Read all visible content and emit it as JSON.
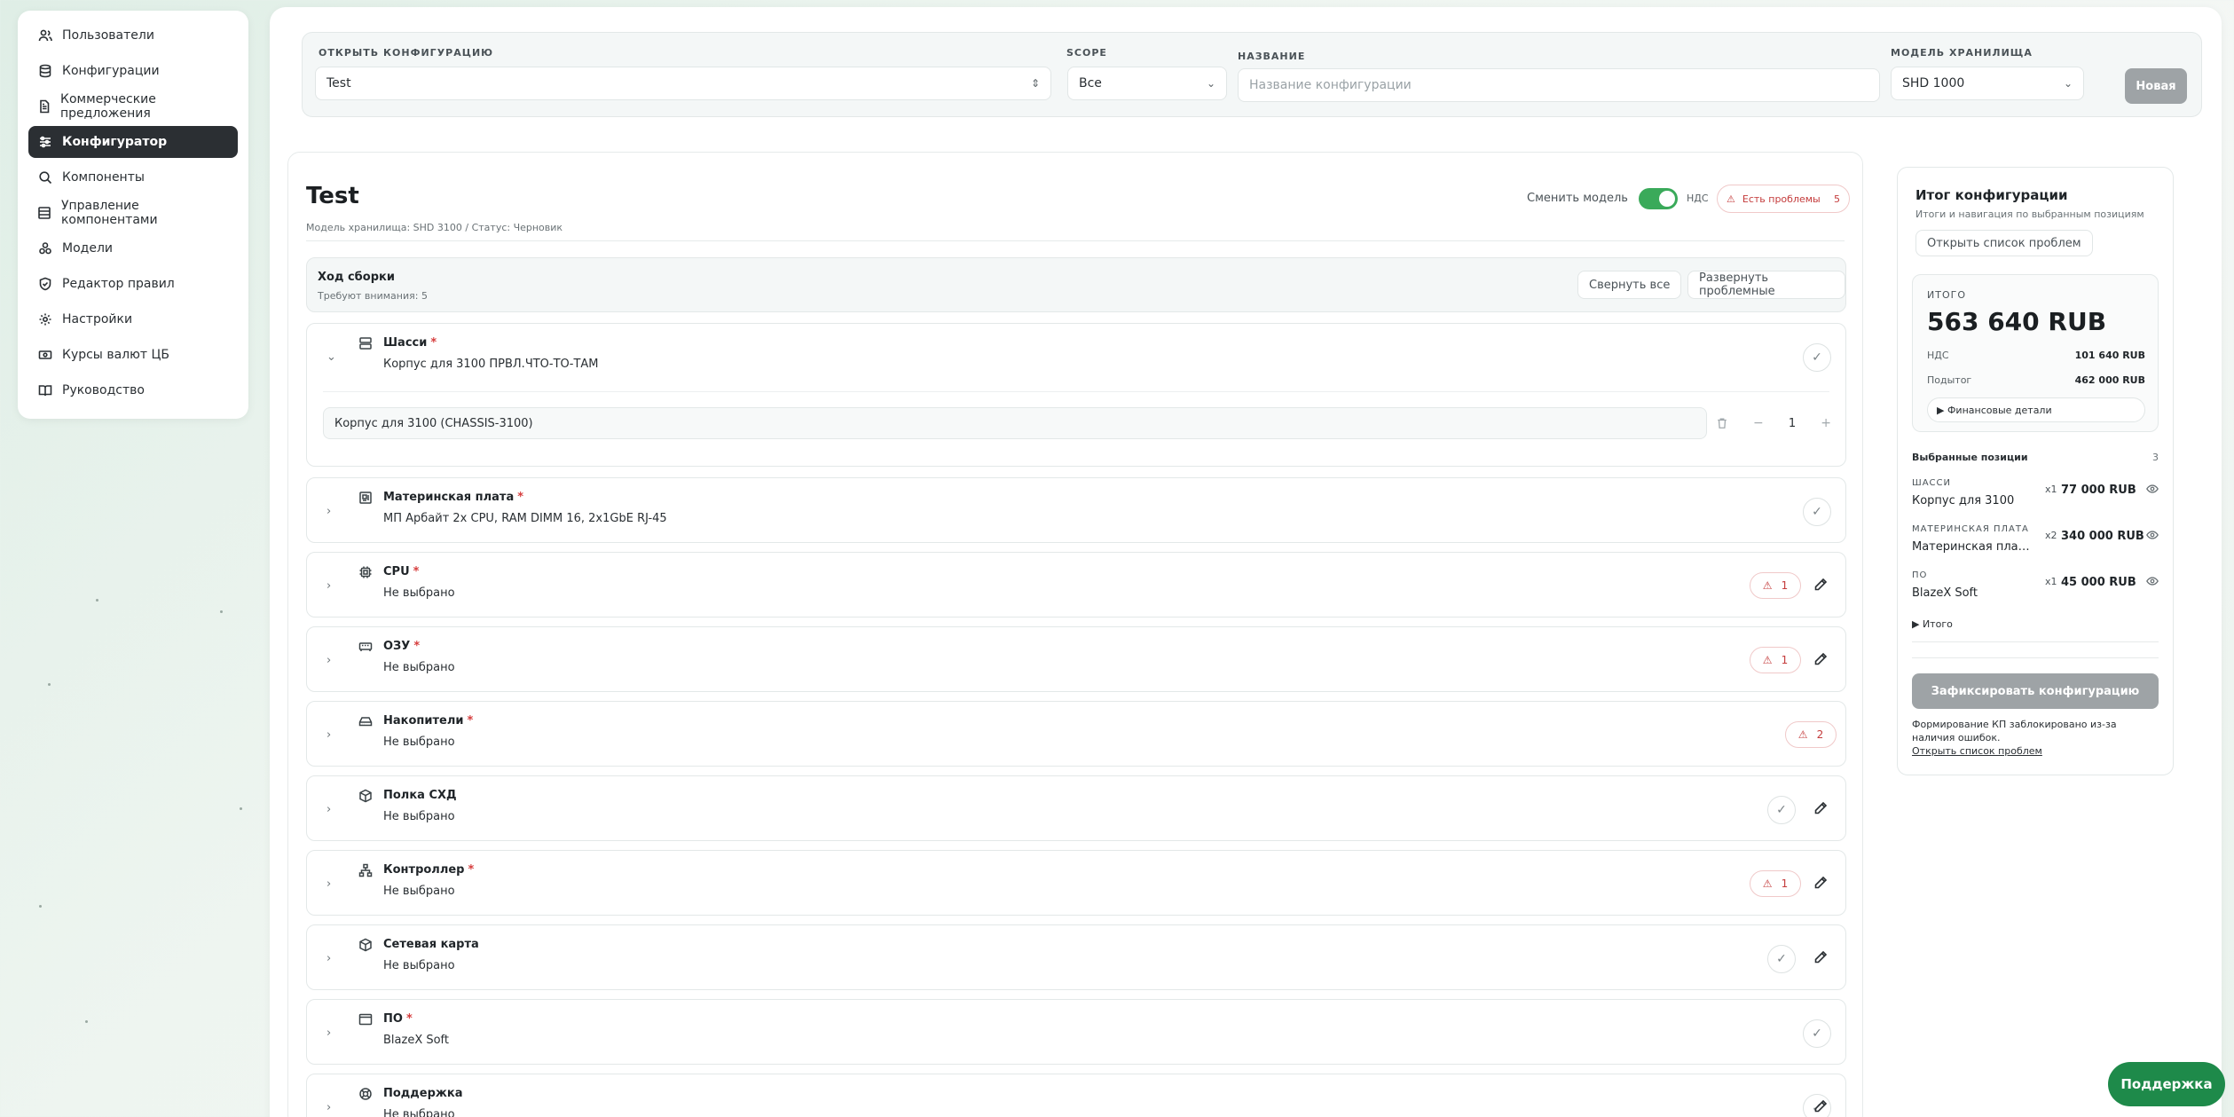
{
  "sidebar": {
    "items": [
      {
        "label": "Пользователи",
        "icon": "users-icon"
      },
      {
        "label": "Конфигурации",
        "icon": "database-icon"
      },
      {
        "label": "Коммерческие предложения",
        "icon": "document-icon"
      },
      {
        "label": "Конфигуратор",
        "icon": "sliders-icon",
        "active": true
      },
      {
        "label": "Компоненты",
        "icon": "search-icon"
      },
      {
        "label": "Управление компонентами",
        "icon": "layout-icon"
      },
      {
        "label": "Модели",
        "icon": "boxes-icon"
      },
      {
        "label": "Редактор правил",
        "icon": "shield-icon"
      },
      {
        "label": "Настройки",
        "icon": "gear-icon"
      },
      {
        "label": "Курсы валют ЦБ",
        "icon": "banknote-icon"
      },
      {
        "label": "Руководство",
        "icon": "book-icon"
      }
    ]
  },
  "topbar": {
    "open_label": "ОТКРЫТЬ КОНФИГУРАЦИЮ",
    "open_value": "Test",
    "scope_label": "SCOPE",
    "scope_value": "Все",
    "name_label": "НАЗВАНИЕ",
    "name_placeholder": "Название конфигурации",
    "model_label": "МОДЕЛЬ ХРАНИЛИЩА",
    "model_value": "SHD 1000",
    "new_button": "Новая"
  },
  "config": {
    "title": "Test",
    "subtitle": "Модель хранилища: SHD 3100 / Статус: Черновик",
    "change_model": "Сменить модель",
    "vat_label": "НДС",
    "vat_enabled": true,
    "issues_label": "Есть проблемы",
    "issues_count": "5",
    "progress_title": "Ход сборки",
    "progress_sub": "Требуют внимания: 5",
    "collapse_all": "Свернуть все",
    "expand_problem": "Развернуть проблемные",
    "required_mark": "*"
  },
  "components": [
    {
      "name": "Шасси",
      "value": "Корпус для 3100 ПРВЛ.ЧТО-ТО-ТАМ",
      "required": true,
      "status": "ok",
      "expanded": true,
      "icon": "server-icon",
      "detail": "Корпус для 3100 (CHASSIS-3100)",
      "qty": "1",
      "minus": "−",
      "plus": "+"
    },
    {
      "name": "Материнская плата",
      "value": "МП Арбайт 2x CPU, RAM DIMM 16, 2x1GbE RJ-45",
      "required": true,
      "status": "ok",
      "icon": "board-icon"
    },
    {
      "name": "CPU",
      "value": "Не выбрано",
      "required": true,
      "status": "warn",
      "warn": "1",
      "editable": true,
      "icon": "cpu-icon"
    },
    {
      "name": "ОЗУ",
      "value": "Не выбрано",
      "required": true,
      "status": "warn",
      "warn": "1",
      "editable": true,
      "icon": "memory-icon"
    },
    {
      "name": "Накопители",
      "value": "Не выбрано",
      "required": true,
      "status": "warn",
      "warn": "2",
      "editable": false,
      "icon": "drive-icon"
    },
    {
      "name": "Полка СХД",
      "value": "Не выбрано",
      "required": false,
      "status": "ok",
      "editable": true,
      "icon": "package-icon"
    },
    {
      "name": "Контроллер",
      "value": "Не выбрано",
      "required": true,
      "status": "warn",
      "warn": "1",
      "editable": true,
      "icon": "network-icon"
    },
    {
      "name": "Сетевая карта",
      "value": "Не выбрано",
      "required": false,
      "status": "ok",
      "editable": true,
      "icon": "package-icon"
    },
    {
      "name": "ПО",
      "value": "BlazeX Soft",
      "required": true,
      "status": "ok",
      "editable": false,
      "icon": "window-icon"
    },
    {
      "name": "Поддержка",
      "value": "Не выбрано",
      "required": false,
      "status": "ok",
      "editable": true,
      "icon": "lifebuoy-icon"
    }
  ],
  "summary": {
    "title": "Итог конфигурации",
    "subtitle": "Итоги и навигация по выбранным позициям",
    "open_issues": "Открыть список проблем",
    "total_label": "ИТОГО",
    "total_amount": "563 640 RUB",
    "vat_label": "НДС",
    "vat_amount": "101 640 RUB",
    "subtotal_label": "Подытог",
    "subtotal_amount": "462 000 RUB",
    "fin_details": "▶ Финансовые детали",
    "selected_label": "Выбранные позиции",
    "selected_count": "3",
    "items": [
      {
        "cat": "ШАССИ",
        "name": "Корпус для 3100",
        "qty": "x1",
        "price": "77 000 RUB"
      },
      {
        "cat": "МАТЕРИНСКАЯ ПЛАТА",
        "name": "Материнская плата ...",
        "qty": "x2",
        "price": "340 000 RUB"
      },
      {
        "cat": "ПО",
        "name": "BlazeX Soft",
        "qty": "x1",
        "price": "45 000 RUB"
      }
    ],
    "itogo_toggle": "▶ Итого",
    "fix_button": "Зафиксировать конфигурацию",
    "block_msg": "Формирование КП заблокировано из-за наличия ошибок.",
    "block_link": "Открыть список проблем"
  },
  "support": "Поддержка"
}
